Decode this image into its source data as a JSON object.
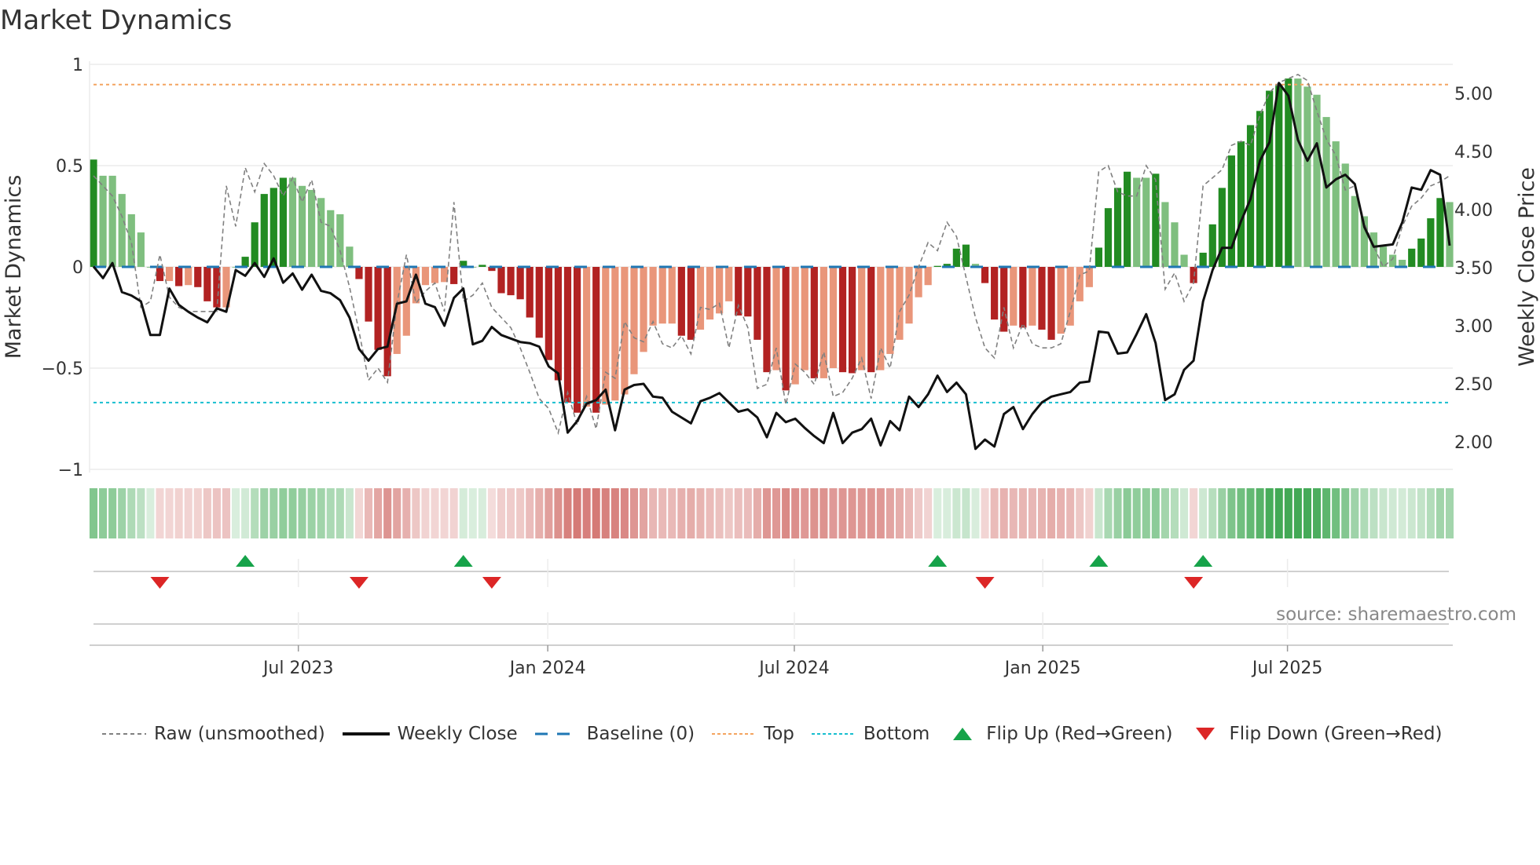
{
  "title": "Market Dynamics",
  "source": "source: sharemaestro.com",
  "legend": {
    "raw": "Raw (unsmoothed)",
    "close": "Weekly Close",
    "baseline": "Baseline (0)",
    "top": "Top",
    "bottom": "Bottom",
    "flip_up": "Flip Up (Red→Green)",
    "flip_down": "Flip Down (Green→Red)"
  },
  "colors": {
    "green_strong": "#228b22",
    "green_weak": "#7fbf7f",
    "red_strong": "#b22222",
    "red_weak": "#e9967a",
    "raw": "#808080",
    "close": "#111111",
    "baseline": "#1f77b4",
    "top": "#f4a460",
    "bottom": "#17becf",
    "flip_up": "#16a34a",
    "flip_down": "#dc2626"
  },
  "chart_data": {
    "type": "bar",
    "title": "Market Dynamics",
    "ylabel": "Market Dynamics",
    "ylabel_right": "Weekly Close Price",
    "ylim": [
      -1,
      1
    ],
    "ylim_right": [
      1.78,
      5.3
    ],
    "yticks": [
      "1",
      "0.5",
      "0",
      "−0.5",
      "−1"
    ],
    "ytick_values": [
      1,
      0.5,
      0,
      -0.5,
      -1
    ],
    "yticks_right": [
      "5.00",
      "4.50",
      "4.00",
      "3.50",
      "3.00",
      "2.50",
      "2.00"
    ],
    "ytick_right_values": [
      5,
      4.5,
      4,
      3.5,
      3,
      2.5,
      2
    ],
    "xticks": [
      "Jul 2023",
      "Jan 2024",
      "Jul 2024",
      "Jan 2025",
      "Jul 2025"
    ],
    "xtick_week_index": [
      21.6,
      47.9,
      73.9,
      100.1,
      125.9
    ],
    "top_level": 0.9,
    "bottom_level": -0.67,
    "baseline": 0,
    "frequency": "weekly",
    "dynamics": [
      0.53,
      0.45,
      0.45,
      0.36,
      0.26,
      0.17,
      0.0,
      -0.07,
      -0.07,
      -0.095,
      -0.09,
      -0.1,
      -0.17,
      -0.2,
      -0.2,
      0.0,
      0.05,
      0.22,
      0.36,
      0.39,
      0.44,
      0.44,
      0.4,
      0.38,
      0.34,
      0.28,
      0.26,
      0.1,
      -0.06,
      -0.27,
      -0.41,
      -0.54,
      -0.43,
      -0.34,
      -0.18,
      -0.09,
      -0.08,
      -0.075,
      -0.085,
      0.03,
      0.0,
      0.01,
      -0.02,
      -0.13,
      -0.14,
      -0.16,
      -0.25,
      -0.35,
      -0.46,
      -0.56,
      -0.67,
      -0.72,
      -0.69,
      -0.72,
      -0.68,
      -0.66,
      -0.63,
      -0.53,
      -0.42,
      -0.29,
      -0.28,
      -0.28,
      -0.34,
      -0.36,
      -0.31,
      -0.26,
      -0.23,
      -0.17,
      -0.24,
      -0.245,
      -0.36,
      -0.52,
      -0.51,
      -0.61,
      -0.58,
      -0.51,
      -0.55,
      -0.55,
      -0.5,
      -0.52,
      -0.525,
      -0.51,
      -0.52,
      -0.51,
      -0.43,
      -0.36,
      -0.28,
      -0.15,
      -0.09,
      0.005,
      0.015,
      0.09,
      0.11,
      0.015,
      -0.08,
      -0.26,
      -0.32,
      -0.29,
      -0.3,
      -0.29,
      -0.31,
      -0.36,
      -0.33,
      -0.29,
      -0.17,
      -0.1,
      0.095,
      0.29,
      0.39,
      0.47,
      0.44,
      0.44,
      0.46,
      0.32,
      0.22,
      0.06,
      -0.08,
      0.07,
      0.21,
      0.39,
      0.55,
      0.62,
      0.7,
      0.77,
      0.87,
      0.9,
      0.93,
      0.93,
      0.89,
      0.85,
      0.74,
      0.62,
      0.51,
      0.35,
      0.25,
      0.17,
      0.1,
      0.06,
      0.035,
      0.09,
      0.14,
      0.24,
      0.34,
      0.32
    ],
    "raw": [
      0.45,
      0.4,
      0.35,
      0.25,
      0.12,
      -0.2,
      -0.17,
      0.06,
      -0.15,
      -0.2,
      -0.22,
      -0.22,
      -0.22,
      -0.22,
      0.4,
      0.2,
      0.49,
      0.37,
      0.51,
      0.45,
      0.35,
      0.44,
      0.32,
      0.43,
      0.22,
      0.2,
      0.08,
      -0.1,
      -0.32,
      -0.56,
      -0.5,
      -0.57,
      -0.18,
      0.06,
      -0.18,
      -0.12,
      -0.08,
      -0.22,
      0.32,
      -0.17,
      -0.14,
      -0.08,
      -0.2,
      -0.25,
      -0.3,
      -0.4,
      -0.52,
      -0.65,
      -0.7,
      -0.82,
      -0.62,
      -0.78,
      -0.64,
      -0.8,
      -0.52,
      -0.55,
      -0.27,
      -0.35,
      -0.37,
      -0.27,
      -0.38,
      -0.4,
      -0.34,
      -0.43,
      -0.2,
      -0.21,
      -0.18,
      -0.4,
      -0.19,
      -0.3,
      -0.6,
      -0.58,
      -0.4,
      -0.68,
      -0.48,
      -0.52,
      -0.58,
      -0.42,
      -0.64,
      -0.62,
      -0.55,
      -0.45,
      -0.65,
      -0.4,
      -0.5,
      -0.22,
      -0.14,
      0.0,
      0.12,
      0.08,
      0.22,
      0.15,
      -0.05,
      -0.25,
      -0.4,
      -0.45,
      -0.2,
      -0.4,
      -0.28,
      -0.38,
      -0.4,
      -0.4,
      -0.38,
      -0.22,
      -0.04,
      -0.02,
      0.47,
      0.5,
      0.37,
      0.35,
      0.35,
      0.5,
      0.43,
      -0.11,
      -0.03,
      -0.17,
      -0.08,
      0.4,
      0.44,
      0.48,
      0.6,
      0.62,
      0.6,
      0.75,
      0.86,
      0.91,
      0.93,
      0.95,
      0.92,
      0.77,
      0.63,
      0.55,
      0.38,
      0.4,
      0.22,
      0.1,
      0.0,
      0.04,
      0.2,
      0.3,
      0.34,
      0.4,
      0.42,
      0.45
    ],
    "close": [
      3.51,
      3.41,
      3.54,
      3.29,
      3.26,
      3.21,
      2.92,
      2.92,
      3.32,
      3.18,
      3.12,
      3.07,
      3.03,
      3.15,
      3.12,
      3.48,
      3.43,
      3.54,
      3.42,
      3.58,
      3.37,
      3.45,
      3.31,
      3.44,
      3.3,
      3.28,
      3.22,
      3.07,
      2.8,
      2.7,
      2.8,
      2.82,
      3.19,
      3.21,
      3.44,
      3.19,
      3.16,
      3.0,
      3.24,
      3.32,
      2.84,
      2.87,
      2.99,
      2.92,
      2.89,
      2.86,
      2.85,
      2.82,
      2.65,
      2.59,
      2.08,
      2.18,
      2.33,
      2.36,
      2.45,
      2.1,
      2.45,
      2.49,
      2.5,
      2.39,
      2.38,
      2.26,
      2.21,
      2.16,
      2.35,
      2.38,
      2.42,
      2.34,
      2.26,
      2.28,
      2.21,
      2.04,
      2.25,
      2.17,
      2.2,
      2.12,
      2.05,
      1.99,
      2.25,
      1.99,
      2.08,
      2.11,
      2.2,
      1.97,
      2.18,
      2.1,
      2.39,
      2.3,
      2.41,
      2.57,
      2.43,
      2.51,
      2.41,
      1.94,
      2.02,
      1.96,
      2.24,
      2.3,
      2.11,
      2.24,
      2.34,
      2.39,
      2.41,
      2.43,
      2.51,
      2.52,
      2.95,
      2.94,
      2.76,
      2.77,
      2.93,
      3.1,
      2.85,
      2.36,
      2.41,
      2.62,
      2.7,
      3.21,
      3.48,
      3.67,
      3.67,
      3.9,
      4.09,
      4.42,
      4.58,
      5.09,
      4.98,
      4.6,
      4.42,
      4.57,
      4.19,
      4.26,
      4.3,
      4.22,
      3.85,
      3.68,
      3.69,
      3.7,
      3.89,
      4.19,
      4.17,
      4.34,
      4.3,
      3.69
    ],
    "flip_up_week_index": [
      16,
      39,
      89,
      106,
      117
    ],
    "flip_down_week_index": [
      7,
      28,
      42,
      94,
      116
    ],
    "legend_position": "bottom"
  }
}
